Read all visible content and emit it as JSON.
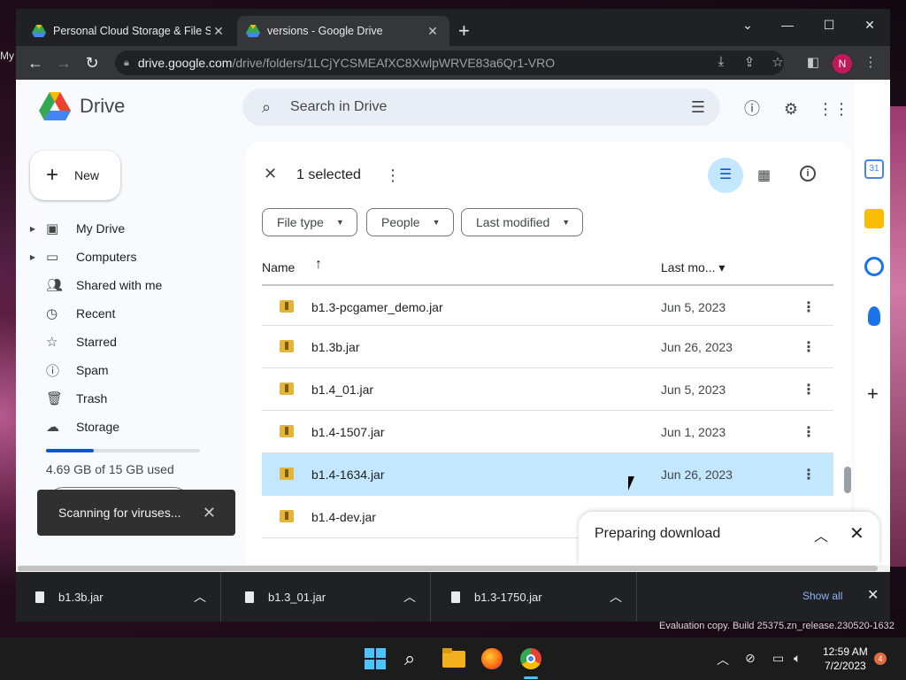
{
  "browser": {
    "tabs": [
      {
        "label": "Personal Cloud Storage & File Sh"
      },
      {
        "label": "versions - Google Drive"
      }
    ],
    "url_host": "drive.google.com",
    "url_path": "/drive/folders/1LCjYCSMEAfXC8XwlpWRVE83a6Qr1-VRO",
    "profile_initial": "N"
  },
  "drive": {
    "logo_text": "Drive",
    "search_placeholder": "Search in Drive",
    "avatar_initial": "N",
    "new_label": "New",
    "sidebar": [
      {
        "label": "My Drive",
        "icon": "my-drive-icon",
        "expandable": true
      },
      {
        "label": "Computers",
        "icon": "computers-icon",
        "expandable": true
      },
      {
        "label": "Shared with me",
        "icon": "shared-icon",
        "expandable": false
      },
      {
        "label": "Recent",
        "icon": "clock-icon",
        "expandable": false
      },
      {
        "label": "Starred",
        "icon": "star-icon",
        "expandable": false
      },
      {
        "label": "Spam",
        "icon": "spam-icon",
        "expandable": false
      },
      {
        "label": "Trash",
        "icon": "trash-icon",
        "expandable": false
      },
      {
        "label": "Storage",
        "icon": "cloud-icon",
        "expandable": false
      }
    ],
    "storage": {
      "text": "4.69 GB of 15 GB used",
      "fraction": 0.31
    },
    "selection": {
      "text": "1 selected"
    },
    "filters": [
      {
        "label": "File type"
      },
      {
        "label": "People"
      },
      {
        "label": "Last modified"
      }
    ],
    "columns": {
      "name": "Name",
      "modified": "Last mo..."
    },
    "files": [
      {
        "name": "b1.3-pcgamer_demo.jar",
        "date": "Jun 5, 2023",
        "selected": false
      },
      {
        "name": "b1.3b.jar",
        "date": "Jun 26, 2023",
        "selected": false
      },
      {
        "name": "b1.4_01.jar",
        "date": "Jun 5, 2023",
        "selected": false
      },
      {
        "name": "b1.4-1507.jar",
        "date": "Jun 1, 2023",
        "selected": false
      },
      {
        "name": "b1.4-1634.jar",
        "date": "Jun 26, 2023",
        "selected": true
      },
      {
        "name": "b1.4-dev.jar",
        "date": "",
        "selected": false
      }
    ],
    "toast": "Scanning for viruses...",
    "download_panel": "Preparing download"
  },
  "download_shelf": {
    "items": [
      {
        "name": "b1.3b.jar"
      },
      {
        "name": "b1.3_01.jar"
      },
      {
        "name": "b1.3-1750.jar"
      }
    ],
    "show_all": "Show all"
  },
  "desktop": {
    "evaluation": "Evaluation copy. Build 25375.zn_release.230520-1632",
    "edge_text": "My"
  },
  "taskbar": {
    "time": "12:59 AM",
    "date": "7/2/2023",
    "notifications": "4"
  },
  "colors": {
    "accent": "#0b57d0",
    "selection": "#c2e7ff",
    "avatar": "#c2185b"
  }
}
